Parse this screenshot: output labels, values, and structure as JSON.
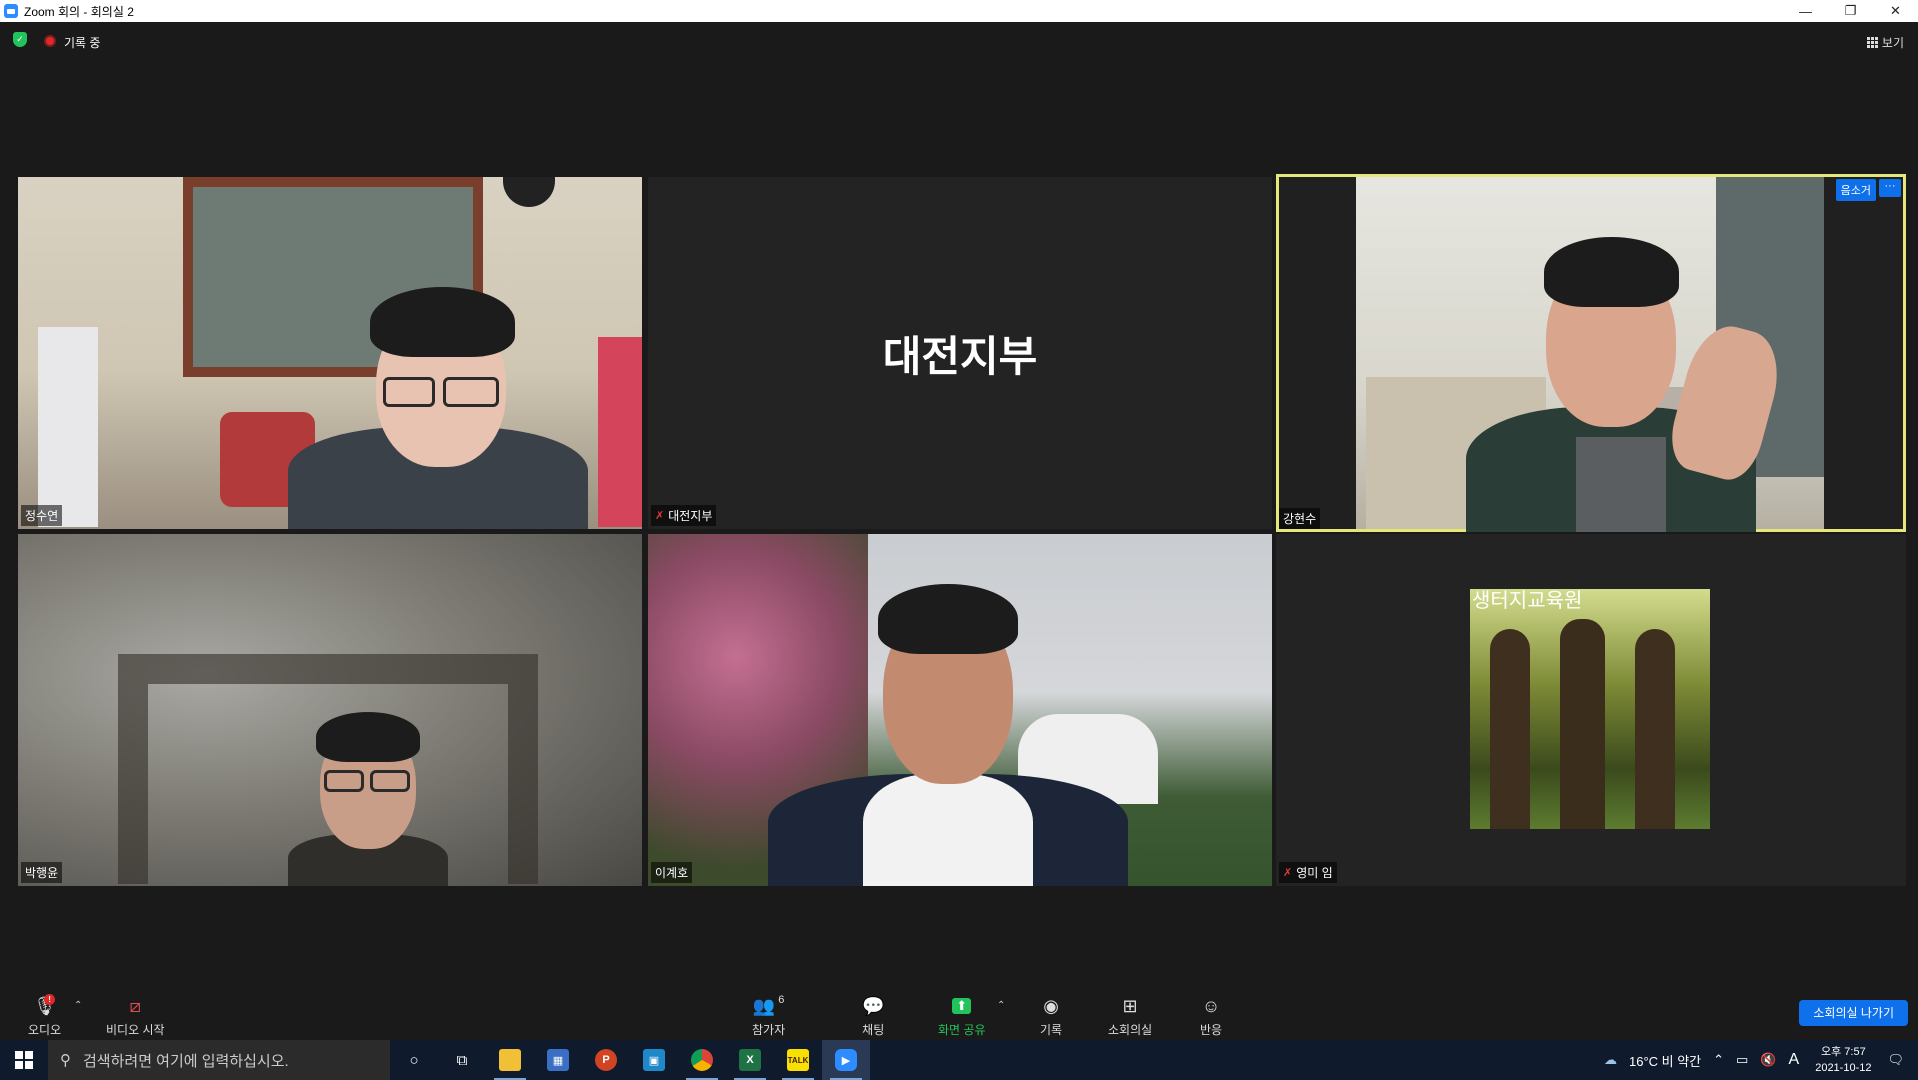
{
  "window": {
    "title": "Zoom 회의 - 회의실 2",
    "minimize": "—",
    "restore": "❐",
    "close": "✕"
  },
  "header": {
    "recording_label": "기록 중",
    "view_label": "보기"
  },
  "tiles": [
    {
      "name": "정수연",
      "muted": false
    },
    {
      "name": "대전지부",
      "muted": true,
      "display_text": "대전지부"
    },
    {
      "name": "강현수",
      "muted": false,
      "active": true,
      "mute_all": "음소거",
      "more": "···"
    },
    {
      "name": "박행윤",
      "muted": false
    },
    {
      "name": "이계호",
      "muted": false
    },
    {
      "name": "영미 임",
      "muted": true,
      "image_caption": "생터지교육원"
    }
  ],
  "controls": {
    "audio": "오디오",
    "video": "비디오 시작",
    "participants": "참가자",
    "participants_count": "6",
    "chat": "채팅",
    "share": "화면 공유",
    "record": "기록",
    "breakout": "소회의실",
    "reactions": "반응",
    "leave_breakout": "소회의실 나가기"
  },
  "taskbar": {
    "search_placeholder": "검색하려면 여기에 입력하십시오.",
    "weather": "16°C  비 약간",
    "ime": "A",
    "time": "오후 7:57",
    "date": "2021-10-12"
  },
  "colors": {
    "zoom_blue": "#0e71eb",
    "active_speaker": "#e4e87a",
    "share_green": "#23c35b",
    "recording_red": "#e02828"
  }
}
